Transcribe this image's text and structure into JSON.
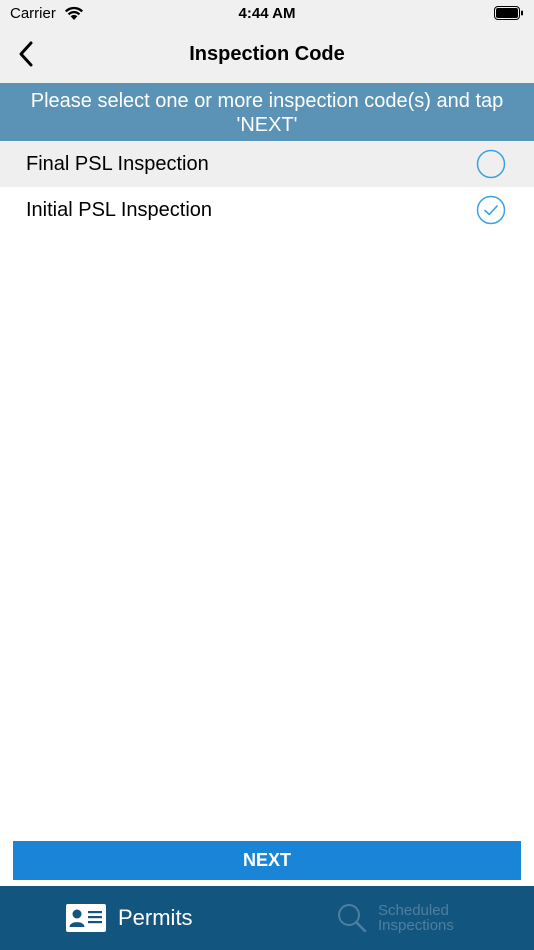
{
  "status_bar": {
    "carrier": "Carrier",
    "time": "4:44 AM"
  },
  "nav": {
    "title": "Inspection Code",
    "back_icon": "chevron-left-icon"
  },
  "instruction": "Please select one or more inspection code(s) and tap 'NEXT'",
  "codes": [
    {
      "label": "Final PSL Inspection",
      "selected": false
    },
    {
      "label": "Initial PSL Inspection",
      "selected": true
    }
  ],
  "next_button": {
    "label": "NEXT"
  },
  "tabs": [
    {
      "label": "Permits",
      "icon": "id-card-icon",
      "active": true
    },
    {
      "label": "Scheduled Inspections",
      "icon": "search-icon",
      "active": false
    }
  ],
  "colors": {
    "banner": "#5b93b6",
    "accent": "#1a85d6",
    "tab_bar": "#12557f",
    "radio": "#3aa3e0"
  }
}
